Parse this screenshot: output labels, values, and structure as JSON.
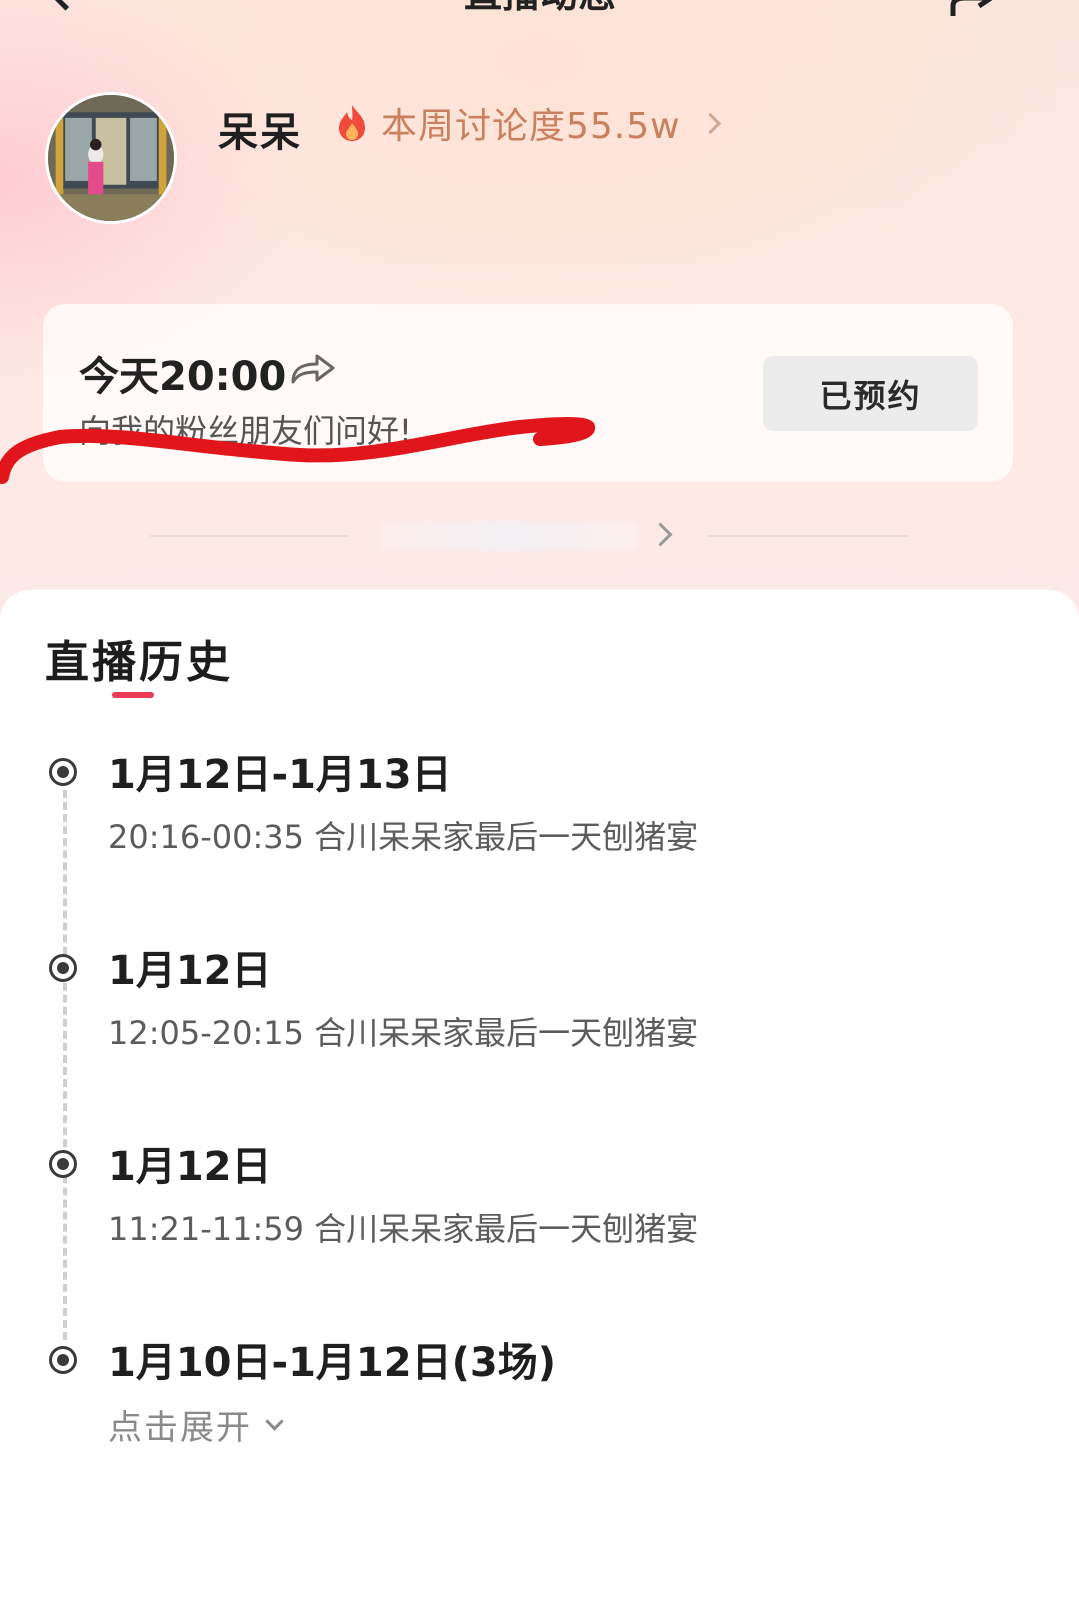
{
  "header": {
    "title": "直播动态"
  },
  "profile": {
    "name": "呆呆",
    "heat_label": "本周讨论度55.5w"
  },
  "upcoming": {
    "time": "今天20:00",
    "message": "向我的粉丝朋友们问好!",
    "button_label": "已预约"
  },
  "history": {
    "title": "直播历史",
    "entries": [
      {
        "date": "1月12日-1月13日",
        "detail": "20:16-00:35 合川呆呆家最后一天刨猪宴"
      },
      {
        "date": "1月12日",
        "detail": "12:05-20:15 合川呆呆家最后一天刨猪宴"
      },
      {
        "date": "1月12日",
        "detail": "11:21-11:59 合川呆呆家最后一天刨猪宴"
      },
      {
        "date": "1月10日-1月12日(3场)",
        "expand_label": "点击展开"
      }
    ]
  },
  "colors": {
    "accent": "#ea3a55",
    "heat_text": "#c9805f",
    "annotation_stroke": "#e0161c"
  },
  "icons": [
    "back-icon",
    "share-icon",
    "flame-icon",
    "chevron-right-icon",
    "forward-arrow-icon",
    "timeline-dot-icon",
    "chevron-down-icon"
  ]
}
